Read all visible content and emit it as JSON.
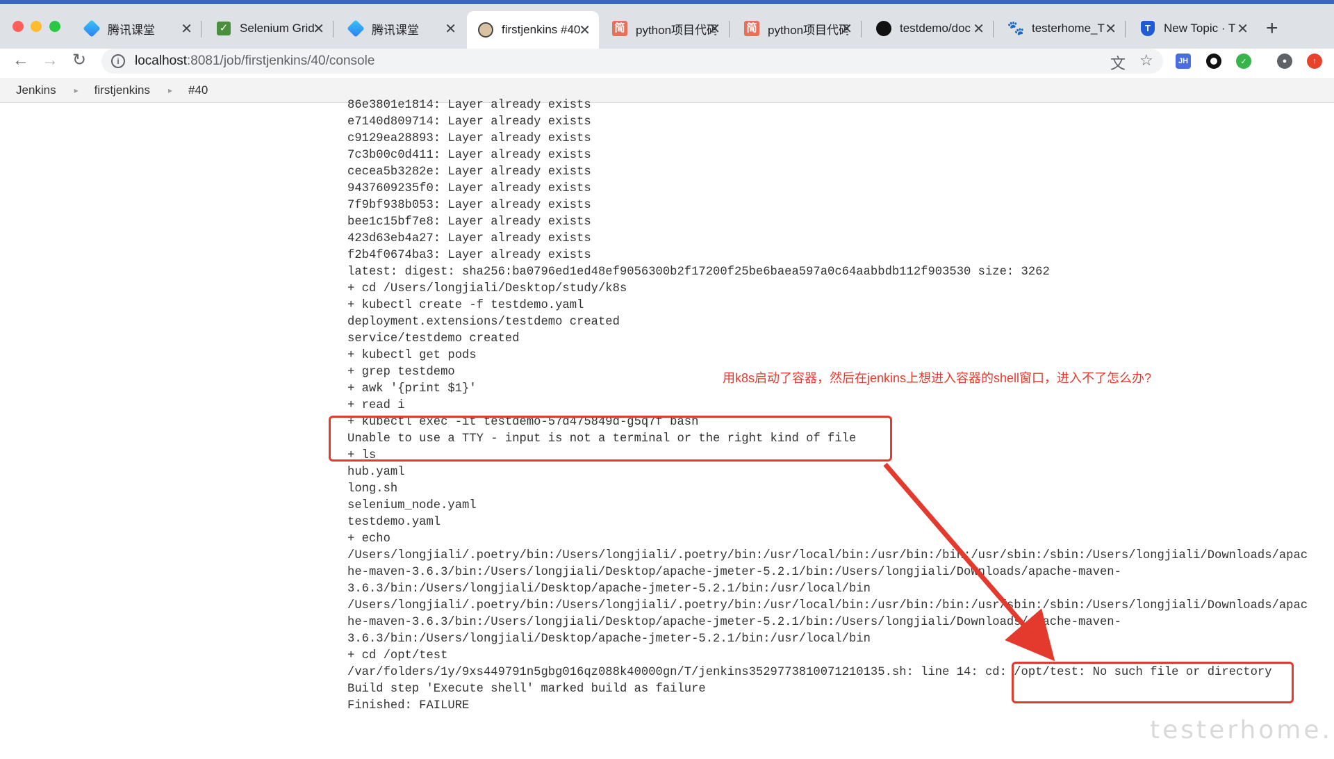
{
  "tabs": [
    {
      "title": "腾讯课堂",
      "icon": "diamond"
    },
    {
      "title": "Selenium Grid",
      "icon": "check"
    },
    {
      "title": "腾讯课堂",
      "icon": "diamond"
    },
    {
      "title": "firstjenkins #40",
      "icon": "jenkins",
      "active": true
    },
    {
      "title": "python项目代码",
      "icon": "jian"
    },
    {
      "title": "python项目代码",
      "icon": "jian"
    },
    {
      "title": "testdemo/doc",
      "icon": "github"
    },
    {
      "title": "testerhome_T",
      "icon": "paw"
    },
    {
      "title": "New Topic · T",
      "icon": "shield"
    }
  ],
  "address_bar": {
    "host": "localhost",
    "path": ":8081/job/firstjenkins/40/console"
  },
  "breadcrumb": [
    "Jenkins",
    "firstjenkins",
    "#40"
  ],
  "console_lines": [
    "86e3801e1814: Layer already exists",
    "e7140d809714: Layer already exists",
    "c9129ea28893: Layer already exists",
    "7c3b00c0d411: Layer already exists",
    "cecea5b3282e: Layer already exists",
    "9437609235f0: Layer already exists",
    "7f9bf938b053: Layer already exists",
    "bee1c15bf7e8: Layer already exists",
    "423d63eb4a27: Layer already exists",
    "f2b4f0674ba3: Layer already exists",
    "latest: digest: sha256:ba0796ed1ed48ef9056300b2f17200f25be6baea597a0c64aabbdb112f903530 size: 3262",
    "+ cd /Users/longjiali/Desktop/study/k8s",
    "+ kubectl create -f testdemo.yaml",
    "deployment.extensions/testdemo created",
    "service/testdemo created",
    "+ kubectl get pods",
    "+ grep testdemo",
    "+ awk '{print $1}'",
    "+ read i",
    "+ kubectl exec -it testdemo-57d475849d-g5q7f bash",
    "Unable to use a TTY - input is not a terminal or the right kind of file",
    "+ ls",
    "hub.yaml",
    "long.sh",
    "selenium_node.yaml",
    "testdemo.yaml",
    "+ echo",
    "/Users/longjiali/.poetry/bin:/Users/longjiali/.poetry/bin:/usr/local/bin:/usr/bin:/bin:/usr/sbin:/sbin:/Users/longjiali/Downloads/apac",
    "he-maven-3.6.3/bin:/Users/longjiali/Desktop/apache-jmeter-5.2.1/bin:/Users/longjiali/Downloads/apache-maven-",
    "3.6.3/bin:/Users/longjiali/Desktop/apache-jmeter-5.2.1/bin:/usr/local/bin",
    "/Users/longjiali/.poetry/bin:/Users/longjiali/.poetry/bin:/usr/local/bin:/usr/bin:/bin:/usr/sbin:/sbin:/Users/longjiali/Downloads/apac",
    "he-maven-3.6.3/bin:/Users/longjiali/Desktop/apache-jmeter-5.2.1/bin:/Users/longjiali/Downloads/apache-maven-",
    "3.6.3/bin:/Users/longjiali/Desktop/apache-jmeter-5.2.1/bin:/usr/local/bin",
    "+ cd /opt/test",
    "/var/folders/1y/9xs449791n5gbg016qz088k40000gn/T/jenkins3529773810071210135.sh: line 14: cd: /opt/test: No such file or directory",
    "Build step 'Execute shell' marked build as failure",
    "Finished: FAILURE"
  ],
  "annotation_text": "用k8s启动了容器，然后在jenkins上想进入容器的shell窗口，进入不了怎么办?",
  "watermark": "testerhome.com",
  "colors": {
    "annotation_red": "#e43a2e",
    "tab_strip": "#dee1e6",
    "accent": "#3c66c4"
  }
}
